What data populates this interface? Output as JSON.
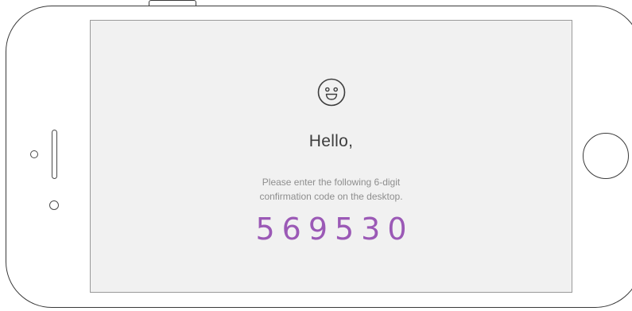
{
  "screen": {
    "icon": "smiley-face-icon",
    "greeting": "Hello,",
    "instruction_line1": "Please enter the following 6-digit",
    "instruction_line2": "confirmation code on the desktop.",
    "code": "569530"
  },
  "colors": {
    "code": "#9b59b6",
    "screen_background": "#f1f1f1",
    "greeting_text": "#3d3d3d",
    "instruction_text": "#8e8e8e"
  }
}
